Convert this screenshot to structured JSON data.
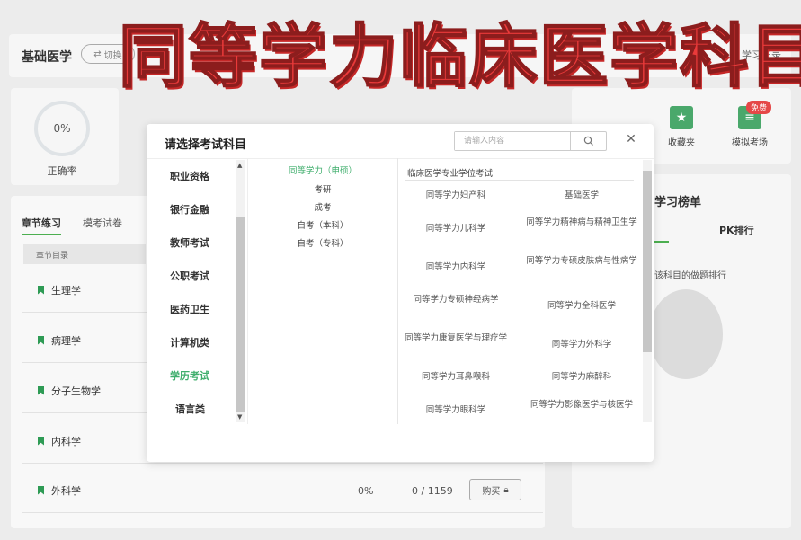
{
  "overlay_title": "同等学力临床医学科目",
  "page": {
    "subject_title": "基础医学",
    "switch_label": "切换",
    "study_record_label": "学习记录",
    "accuracy_value": "0%",
    "accuracy_label": "正确率",
    "tabs": [
      "章节练习",
      "模考试卷"
    ],
    "chapter_header": "章节目录",
    "chapters": [
      "生理学",
      "病理学",
      "分子生物学",
      "内科学",
      "外科学"
    ],
    "last_row": {
      "percent": "0%",
      "count": "0 / 1159",
      "buy_label": "购买"
    },
    "tools": [
      "收藏夹",
      "模拟考场"
    ],
    "free_badge": "免费",
    "rank_title": "学习榜单",
    "pk_tab": "PK排行",
    "rank_desc": "该科目的做题排行"
  },
  "modal": {
    "title": "请选择考试科目",
    "search_placeholder": "请输入内容",
    "categories": [
      "职业资格",
      "银行金融",
      "教师考试",
      "公职考试",
      "医药卫生",
      "计算机类",
      "学历考试",
      "语言类"
    ],
    "active_category": "学历考试",
    "subcategories": [
      "同等学力（申硕）",
      "考研",
      "成考",
      "自考（本科）",
      "自考（专科）"
    ],
    "active_subcategory": "同等学力（申硕）",
    "exam_group": "临床医学专业学位考试",
    "exams": [
      [
        "同等学力妇产科",
        "基础医学"
      ],
      [
        "同等学力儿科学",
        "同等学力精神病与精神卫生学"
      ],
      [
        "同等学力内科学",
        "同等学力专硕皮肤病与性病学"
      ],
      [
        "同等学力专硕神经病学",
        "同等学力全科医学"
      ],
      [
        "同等学力康复医学与理疗学",
        "同等学力外科学"
      ],
      [
        "同等学力耳鼻喉科",
        "同等学力麻醉科"
      ],
      [
        "同等学力眼科学",
        "同等学力影像医学与核医学"
      ]
    ]
  }
}
